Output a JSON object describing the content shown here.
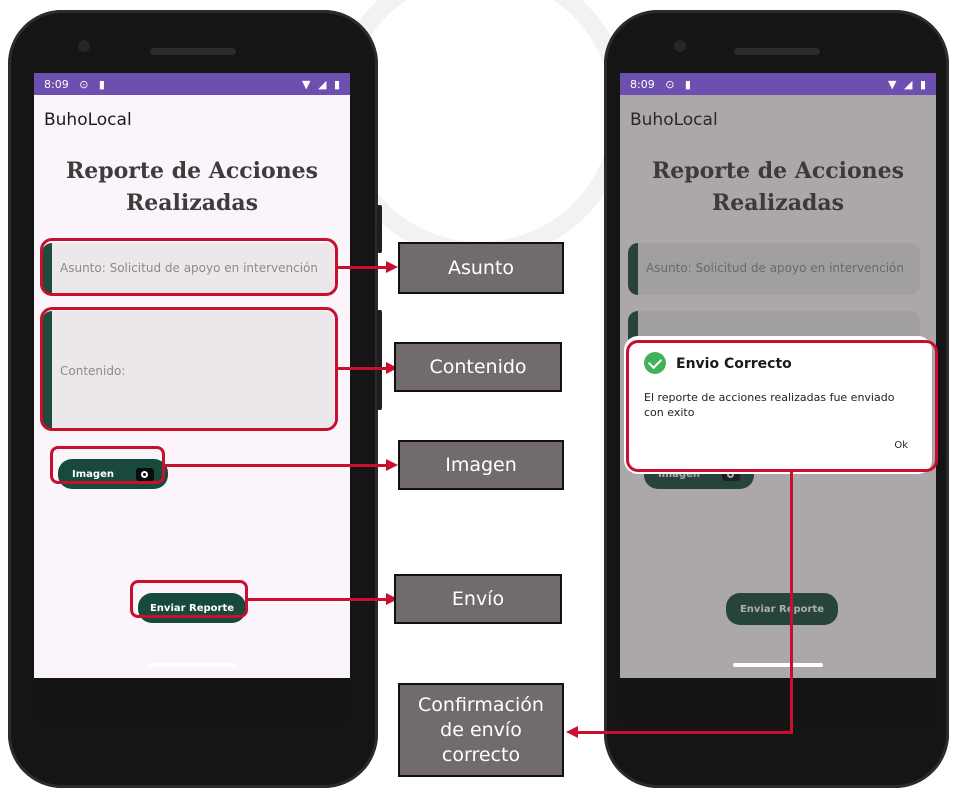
{
  "phones": {
    "status": {
      "time": "8:09"
    },
    "app_title": "BuhoLocal",
    "report_title_line1": "Reporte de Acciones",
    "report_title_line2": "Realizadas",
    "asunto_field": "Asunto:  Solicitud de apoyo en intervención",
    "contenido_field": "Contenido:",
    "imagen_button": "Imagen",
    "enviar_button": "Enviar Reporte"
  },
  "dialog": {
    "title": "Envio Correcto",
    "message": "El reporte de acciones realizadas fue enviado con exito",
    "ok_label": "Ok"
  },
  "annotations": {
    "asunto": "Asunto",
    "contenido": "Contenido",
    "imagen": "Imagen",
    "envio": "Envío",
    "confirmacion": "Confirmación de envío correcto"
  },
  "colors": {
    "status_bar": "#6d4fb0",
    "button_green": "#174a3c",
    "highlight_red": "#c8102e",
    "label_gray": "#716b6c",
    "success_green": "#41b25a"
  },
  "icons": [
    "camera-icon",
    "check-circle-icon",
    "wifi-icon",
    "signal-icon",
    "battery-icon",
    "location-icon",
    "sim-icon"
  ]
}
